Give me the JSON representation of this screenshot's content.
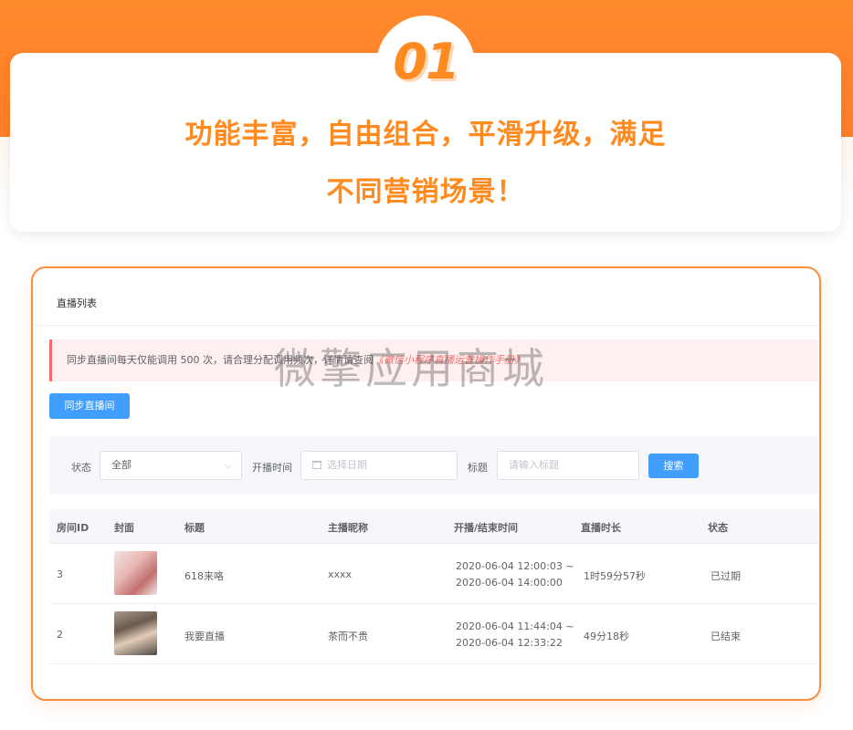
{
  "hero": {
    "badge": "01",
    "line1": "功能丰富，自由组合，平滑升级，满足",
    "line2": "不同营销场景！"
  },
  "panel": {
    "title": "直播列表",
    "alert_text": "同步直播间每天仅能调用 500 次，请合理分配调用频次，详情请查阅",
    "alert_link": "《微信小程序直播运营操作手册》",
    "sync_button": "同步直播间"
  },
  "filters": {
    "status_label": "状态",
    "status_value": "全部",
    "date_label": "开播时间",
    "date_placeholder": "选择日期",
    "title_label": "标题",
    "title_placeholder": "请输入标题",
    "search_button": "搜索"
  },
  "table": {
    "headers": [
      "房间ID",
      "封面",
      "标题",
      "主播昵称",
      "开播/结束时间",
      "直播时长",
      "状态"
    ],
    "rows": [
      {
        "id": "3",
        "title": "618来咯",
        "anchor": "xxxx",
        "start": "2020-06-04 12:00:03 ~",
        "end": "2020-06-04 14:00:00",
        "duration": "1时59分57秒",
        "status": "已过期"
      },
      {
        "id": "2",
        "title": "我要直播",
        "anchor": "茶而不贵",
        "start": "2020-06-04 11:44:04 ~",
        "end": "2020-06-04 12:33:22",
        "duration": "49分18秒",
        "status": "已结束"
      }
    ]
  },
  "watermark": "微擎应用商城",
  "colors": {
    "accent_orange": "#ff8a1f",
    "primary_blue": "#409eff",
    "alert_red": "#f56c6c"
  }
}
